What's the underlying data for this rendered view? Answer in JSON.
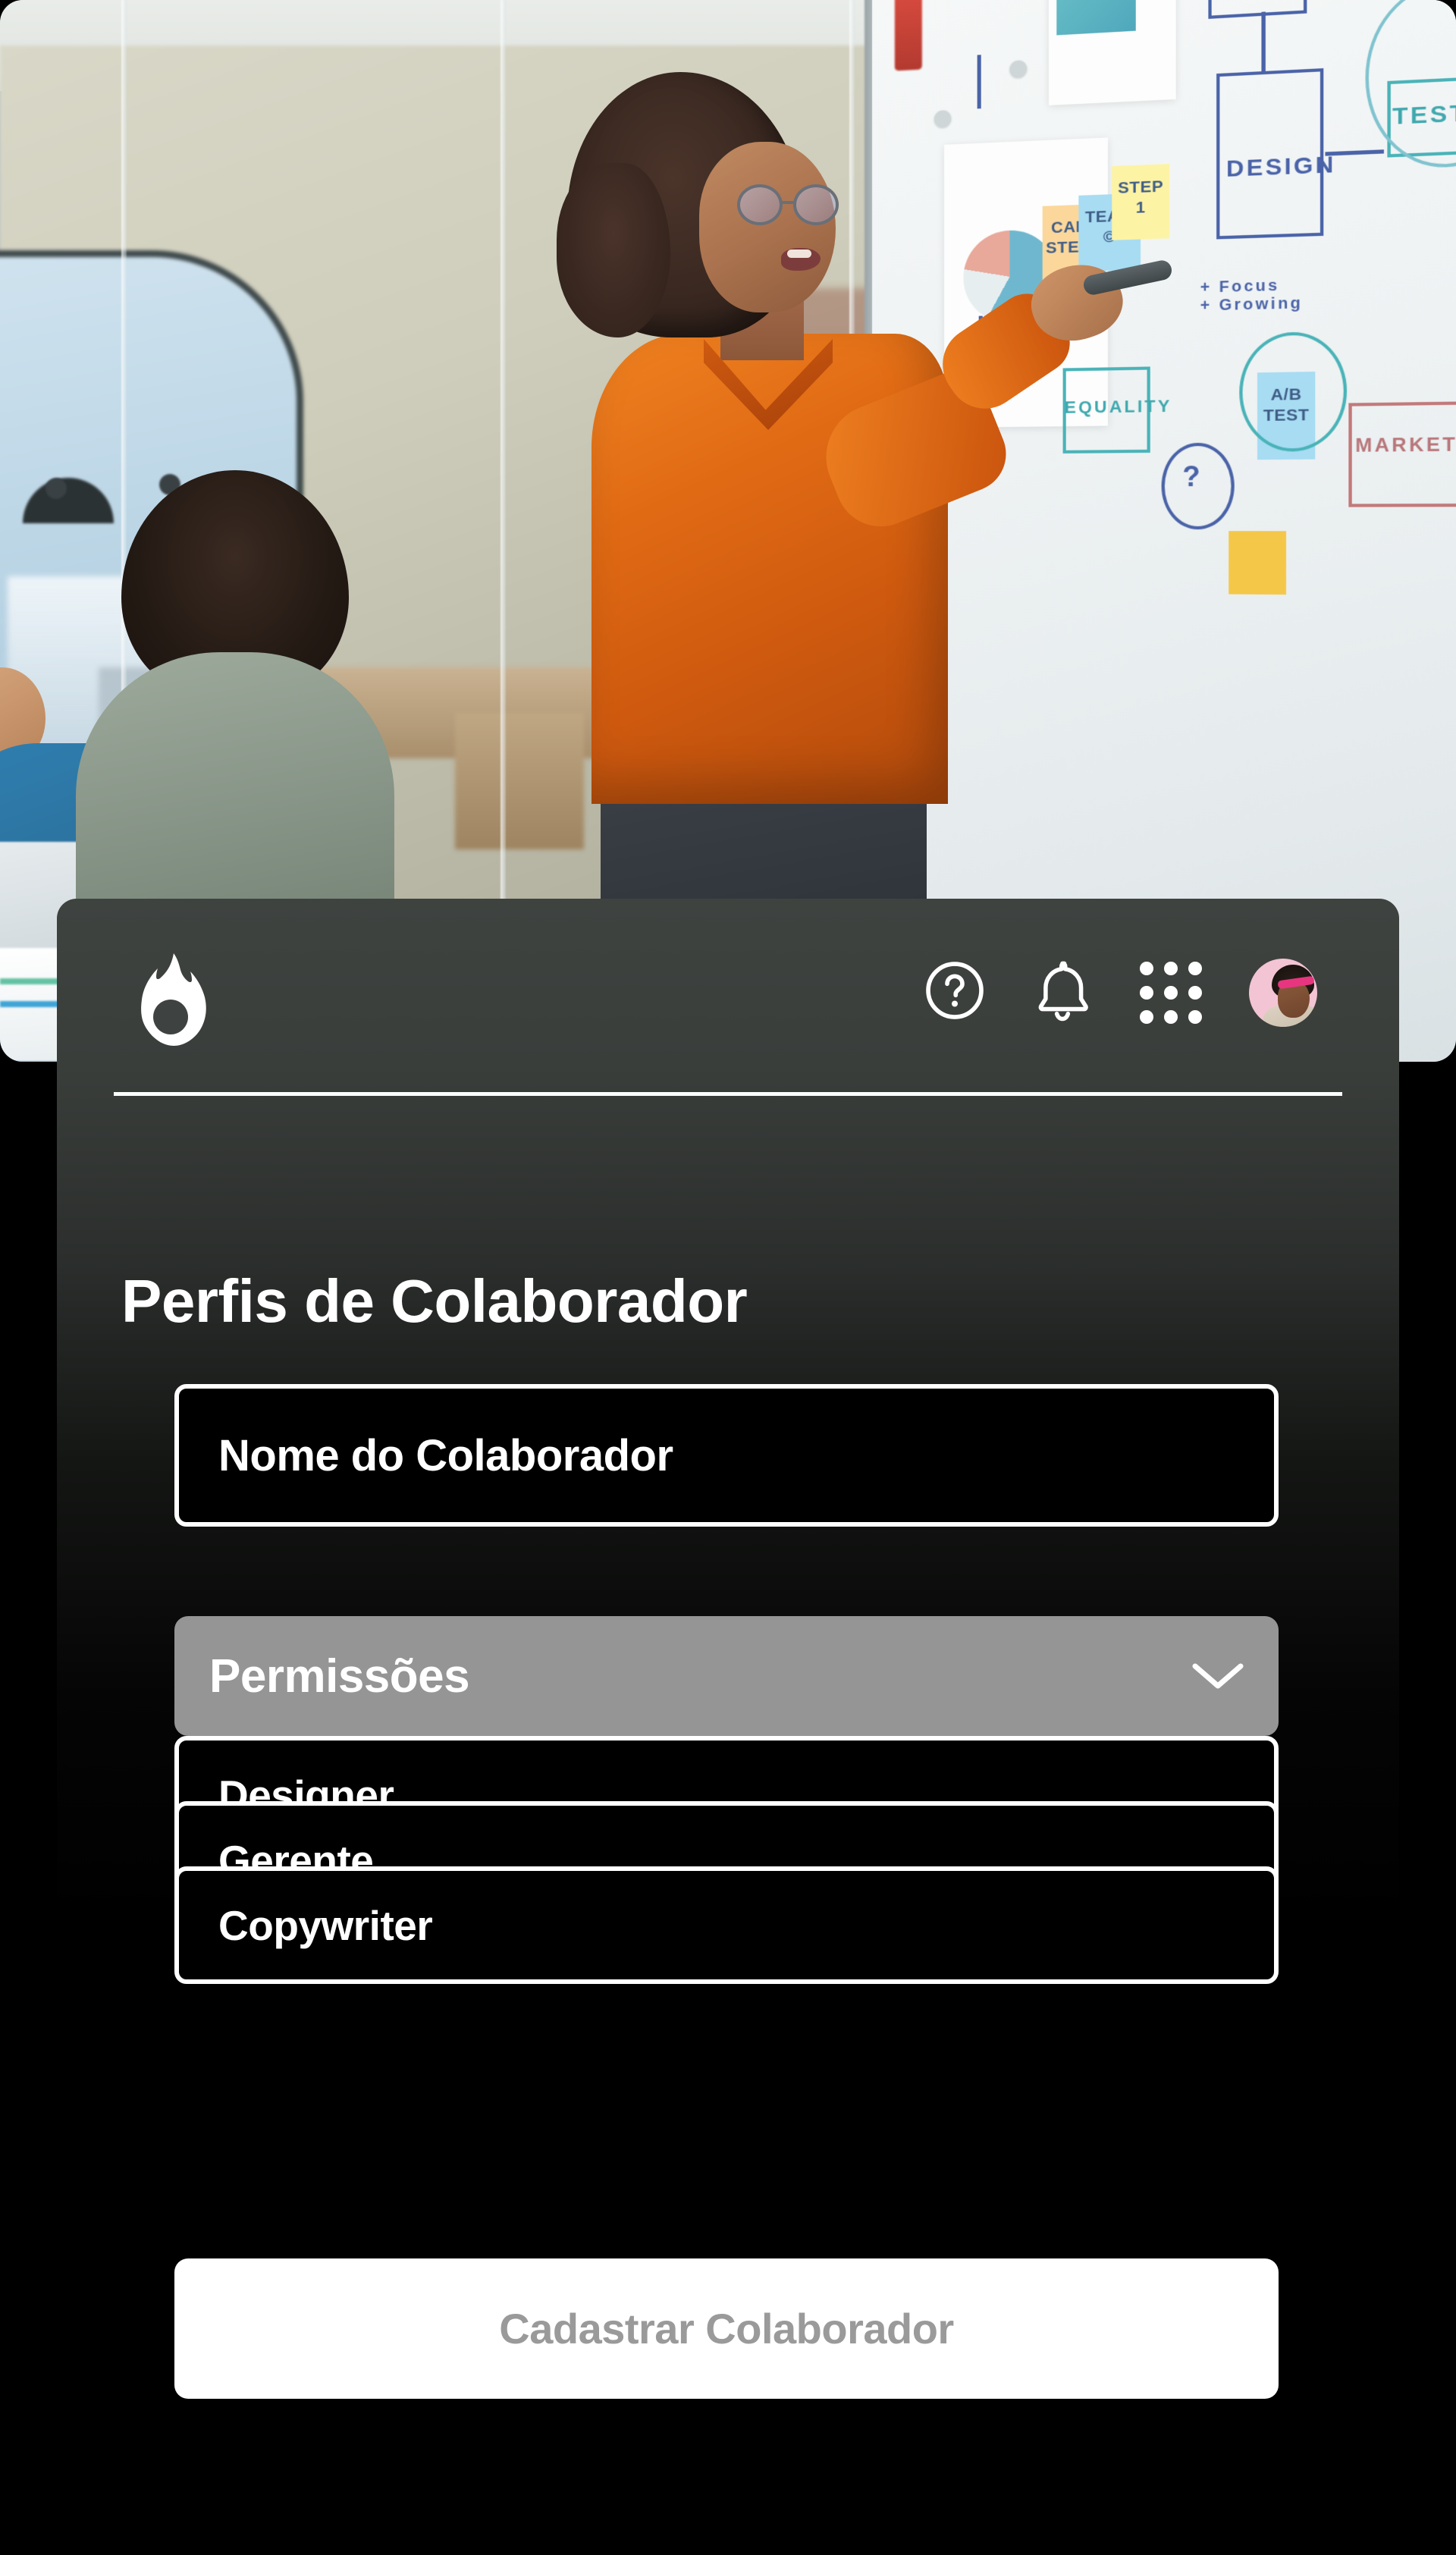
{
  "app": {
    "brand_icon": "flame-logo",
    "panel_bg": "#000000",
    "accent_gray": "#959595"
  },
  "topbar": {
    "help_icon": "question-circle-icon",
    "notifications_icon": "bell-icon",
    "apps_icon": "grid-apps-icon",
    "avatar_label": "user-avatar"
  },
  "page": {
    "title": "Perfis de Colaborador"
  },
  "form": {
    "name_field": {
      "label": "Nome do Colaborador",
      "value": "Nome do Colaborador",
      "placeholder": "Nome do Colaborador"
    },
    "permissions_select": {
      "label": "Permissões",
      "chevron_icon": "chevron-down-icon",
      "options": [
        {
          "label": "Designer"
        },
        {
          "label": "Gerente"
        },
        {
          "label": "Copywriter"
        }
      ]
    },
    "submit_button": {
      "label": "Cadastrar Colaborador"
    }
  },
  "hero": {
    "alt": "whiteboard-presentation-photo",
    "whiteboard_notes": [
      {
        "text": "CALL\nSTEVE",
        "color": "orange"
      },
      {
        "text": "TEAM\n©",
        "color": "blue"
      },
      {
        "text": "STEP\n1",
        "color": "yellow"
      },
      {
        "text": "A/B\nTEST",
        "color": "blue"
      }
    ],
    "whiteboard_labels": [
      "DESIGN",
      "TEST",
      "MARKETING",
      "EQUALITY"
    ]
  }
}
